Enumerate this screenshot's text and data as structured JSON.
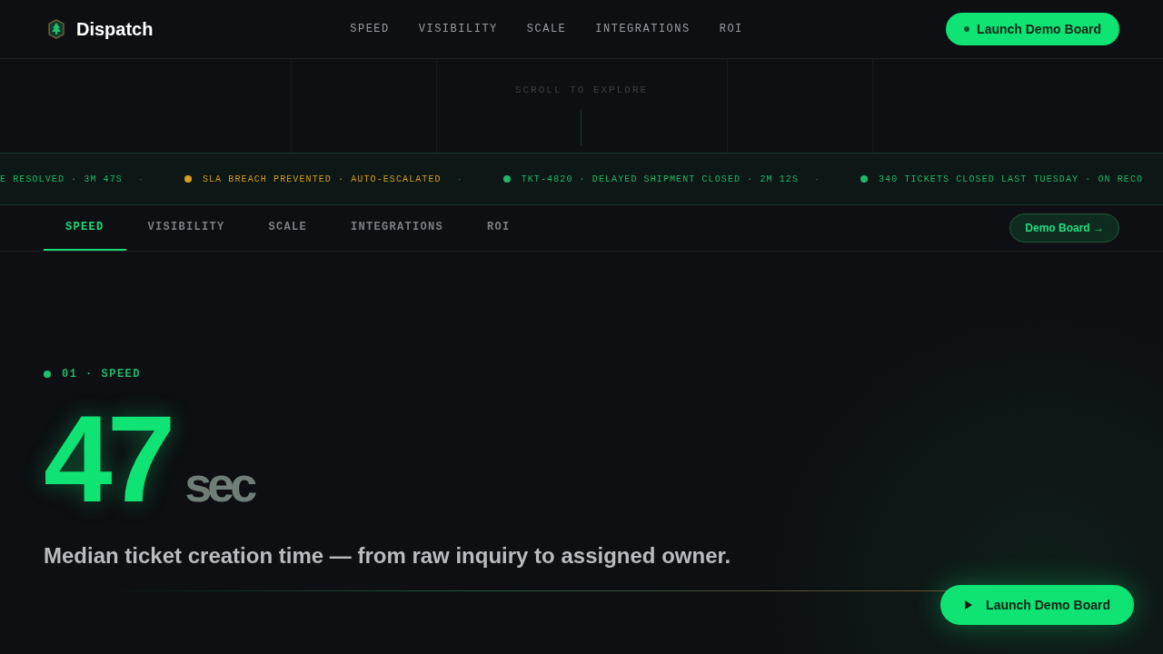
{
  "brand": {
    "name": "Dispatch"
  },
  "nav": [
    {
      "label": "SPEED"
    },
    {
      "label": "VISIBILITY"
    },
    {
      "label": "SCALE"
    },
    {
      "label": "INTEGRATIONS"
    },
    {
      "label": "ROI"
    }
  ],
  "header_button": {
    "label": "Launch Demo Board"
  },
  "hero": {
    "hint": "SCROLL TO EXPLORE"
  },
  "ticker": [
    {
      "kind": "event",
      "text": "E RESOLVED · 3M 47S",
      "color": "#1fb86a",
      "dot": false
    },
    {
      "kind": "separator",
      "text": "·"
    },
    {
      "kind": "event",
      "text": "SLA BREACH PREVENTED · AUTO-ESCALATED",
      "color": "#d69e1e",
      "dot": true
    },
    {
      "kind": "separator",
      "text": "·"
    },
    {
      "kind": "event",
      "text": "TKT-4820 · DELAYED SHIPMENT CLOSED · 2M 12S",
      "color": "#1fb86a",
      "dot": true
    },
    {
      "kind": "separator",
      "text": "·"
    },
    {
      "kind": "event",
      "text": "340 TICKETS CLOSED LAST TUESDAY · ON RECO",
      "color": "#1fb86a",
      "dot": true
    }
  ],
  "tabs": [
    {
      "label": "SPEED",
      "selected": true
    },
    {
      "label": "VISIBILITY",
      "selected": false
    },
    {
      "label": "SCALE",
      "selected": false
    },
    {
      "label": "INTEGRATIONS",
      "selected": false
    },
    {
      "label": "ROI",
      "selected": false
    }
  ],
  "tab_button": {
    "label": "Demo Board →"
  },
  "section": {
    "eyebrow": "01 · SPEED",
    "value": "47",
    "unit": "sec",
    "caption": "Median ticket creation time — from raw inquiry to assigned owner."
  },
  "floating_button": {
    "label": "Launch Demo Board"
  }
}
